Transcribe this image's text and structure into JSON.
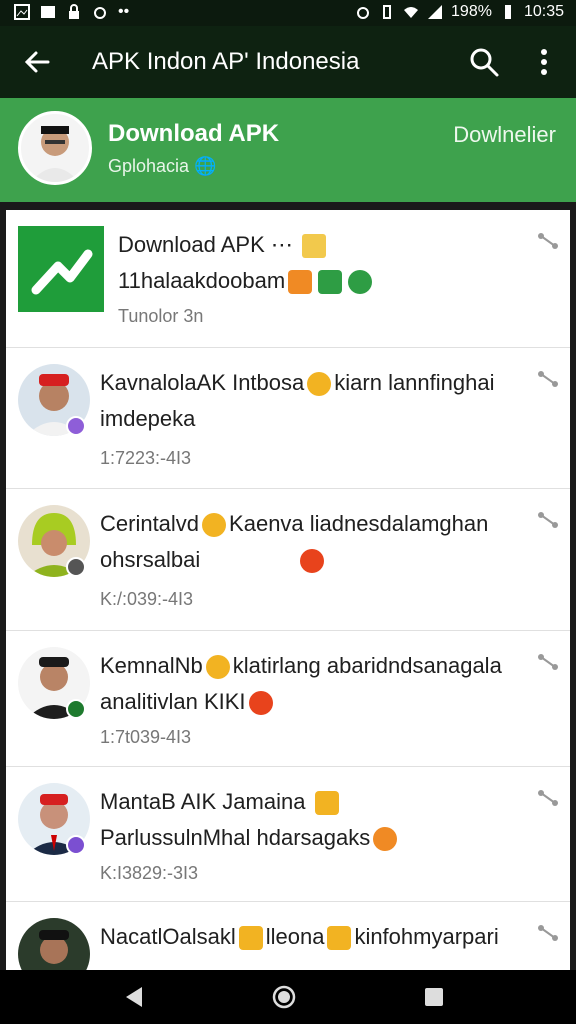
{
  "status": {
    "battery": "198%",
    "time": "10:35"
  },
  "appbar": {
    "title": "APK Indon AP' Indonesia",
    "icons": [
      "back-arrow-icon",
      "search-icon",
      "more-vert-icon"
    ]
  },
  "channel": {
    "name": "Download APK",
    "sub": "Gplohacia",
    "action": "Dowlnelier"
  },
  "feed": [
    {
      "line1": "Download APK ⋯",
      "line2": "11halaakdoobam",
      "meta": "Tunolor 3n"
    },
    {
      "line1": "KavnalolaAK Intbosa",
      "line1b": "kiarn lannfinghai",
      "line2": "imdepeka",
      "meta": "1:7223:-4I3"
    },
    {
      "line1": "Cerintalvd",
      "line1b": "Kaenva liadnesdalamghan",
      "line2": "ohsrsalbai",
      "meta": "K:/:039:-4I3"
    },
    {
      "line1": "KemnalNb",
      "line1b": "klatirlang abaridndsanagala",
      "line2": "analitivlan KIKI",
      "meta": "1:7t039-4I3"
    },
    {
      "line1": "MantaB AIK Jamaina",
      "line2": "ParlussulnMhal hdarsagaks",
      "meta": "K:I3829:-3I3"
    },
    {
      "line1": "NacatlOalsakl",
      "line1b": "lleona",
      "line1c": "kinfohmyarpari",
      "line2": ""
    }
  ],
  "colors": {
    "header": "#3ea24d",
    "appbar": "#0e2211"
  }
}
